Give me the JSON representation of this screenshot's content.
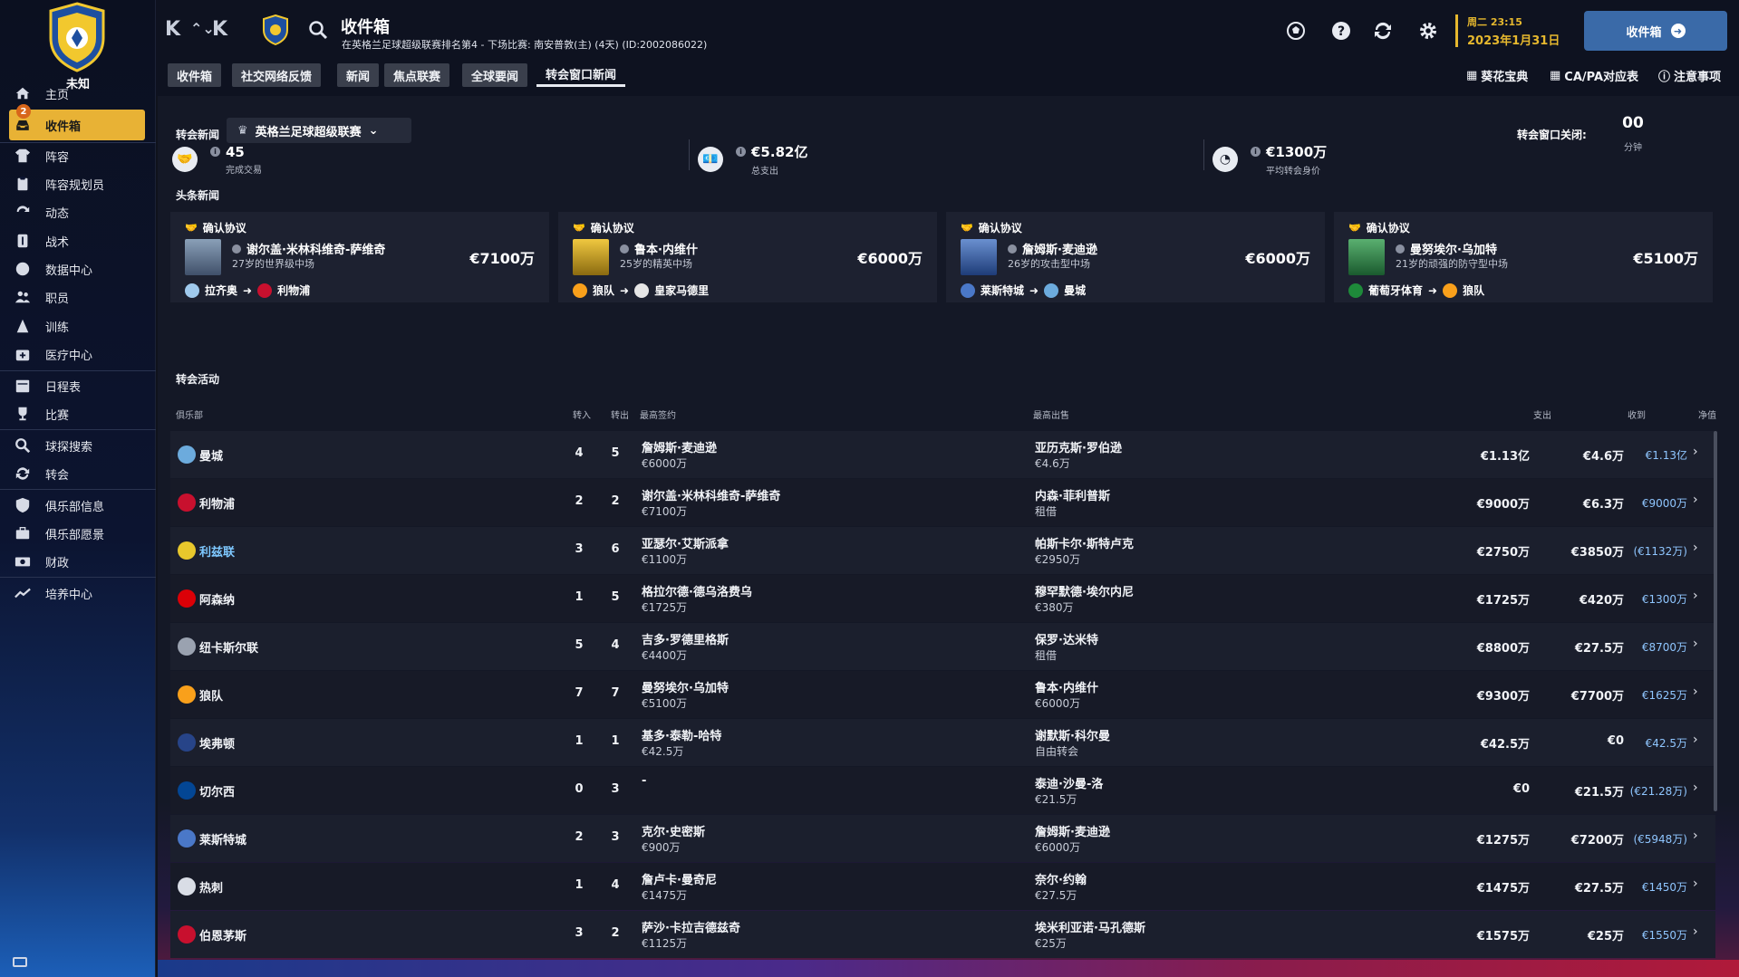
{
  "club": {
    "name": "未知"
  },
  "sidebar": {
    "items": [
      {
        "label": "主页",
        "icon": "home-icon"
      },
      {
        "label": "收件箱",
        "icon": "inbox-icon",
        "badge": "2"
      },
      {
        "label": "阵容",
        "icon": "squad-shirt-icon"
      },
      {
        "label": "阵容规划员",
        "icon": "clipboard-icon"
      },
      {
        "label": "动态",
        "icon": "dynamics-icon"
      },
      {
        "label": "战术",
        "icon": "tactics-icon"
      },
      {
        "label": "数据中心",
        "icon": "data-hub-icon"
      },
      {
        "label": "职员",
        "icon": "staff-icon"
      },
      {
        "label": "训练",
        "icon": "training-icon"
      },
      {
        "label": "医疗中心",
        "icon": "medical-icon"
      },
      {
        "label": "日程表",
        "icon": "calendar-icon"
      },
      {
        "label": "比赛",
        "icon": "trophy-icon"
      },
      {
        "label": "球探搜索",
        "icon": "scouting-icon"
      },
      {
        "label": "转会",
        "icon": "transfers-icon"
      },
      {
        "label": "俱乐部信息",
        "icon": "club-info-icon"
      },
      {
        "label": "俱乐部愿景",
        "icon": "club-vision-icon"
      },
      {
        "label": "财政",
        "icon": "finances-icon"
      },
      {
        "label": "培养中心",
        "icon": "development-icon"
      }
    ]
  },
  "header": {
    "title": "收件箱",
    "subtitle": "在英格兰足球超级联赛排名第4 - 下场比赛: 南安普敦(主) (4天) (ID:2002086022)",
    "date_day": "周二 23:15",
    "date_full": "2023年1月31日",
    "inbox_button": "收件箱"
  },
  "tabs": [
    "收件箱",
    "社交网络反馈",
    "新闻",
    "焦点联赛",
    "全球要闻",
    "转会窗口新闻"
  ],
  "active_tab": 5,
  "top_links": [
    "葵花宝典",
    "CA/PA对应表",
    "注意事项"
  ],
  "transfer_news": {
    "label": "转会新闻",
    "league": "英格兰足球超级联赛",
    "window_close_label": "转会窗口关闭:",
    "window_close_value": "00",
    "window_close_unit": "分钟"
  },
  "stats": [
    {
      "value": "45",
      "label": "完成交易",
      "icon": "handshake-icon"
    },
    {
      "value": "€5.82亿",
      "label": "总支出",
      "icon": "money-icon"
    },
    {
      "value": "€1300万",
      "label": "平均转会身价",
      "icon": "average-value-icon"
    }
  ],
  "headlines_label": "头条新闻",
  "headlines": [
    {
      "status": "确认协议",
      "player": "谢尔盖·米林科维奇-萨维奇",
      "desc": "27岁的世界级中场",
      "fee": "€7100万",
      "from": "拉齐奥",
      "to": "利物浦",
      "photo_color": "#6a7f9a",
      "from_color": "#9fc9ec",
      "to_color": "#c8102e"
    },
    {
      "status": "确认协议",
      "player": "鲁本·内维什",
      "desc": "25岁的精英中场",
      "fee": "€6000万",
      "from": "狼队",
      "to": "皇家马德里",
      "photo_color": "#e0b020",
      "from_color": "#f9a01b",
      "to_color": "#e6e6e6"
    },
    {
      "status": "确认协议",
      "player": "詹姆斯·麦迪逊",
      "desc": "26岁的攻击型中场",
      "fee": "€6000万",
      "from": "莱斯特城",
      "to": "曼城",
      "photo_color": "#3a66b0",
      "from_color": "#4a78c8",
      "to_color": "#6cabdd"
    },
    {
      "status": "确认协议",
      "player": "曼努埃尔·乌加特",
      "desc": "21岁的顽强的防守型中场",
      "fee": "€5100万",
      "from": "葡萄牙体育",
      "to": "狼队",
      "photo_color": "#2f8a4a",
      "from_color": "#1e8a3a",
      "to_color": "#f9a01b"
    }
  ],
  "activity_label": "转会活动",
  "table_headers": {
    "club": "俱乐部",
    "in": "转入",
    "out": "转出",
    "top_signing": "最高签约",
    "top_sale": "最高出售",
    "spend": "支出",
    "received": "收到",
    "net": "净值"
  },
  "rows": [
    {
      "club": "曼城",
      "crest": "#6cabdd",
      "in": "4",
      "out": "5",
      "sign": "詹姆斯·麦迪逊",
      "sign_fee": "€6000万",
      "sale": "亚历克斯·罗伯逊",
      "sale_fee": "€4.6万",
      "spend": "€1.13亿",
      "received": "€4.6万",
      "net": "€1.13亿"
    },
    {
      "club": "利物浦",
      "crest": "#c8102e",
      "in": "2",
      "out": "2",
      "sign": "谢尔盖·米林科维奇-萨维奇",
      "sign_fee": "€7100万",
      "sale": "内森·菲利普斯",
      "sale_fee": "租借",
      "spend": "€9000万",
      "received": "€6.3万",
      "net": "€9000万"
    },
    {
      "club": "利兹联",
      "crest": "#e8c82c",
      "highlight": true,
      "in": "3",
      "out": "6",
      "sign": "亚瑟尔·艾斯派拿",
      "sign_fee": "€1100万",
      "sale": "帕斯卡尔·斯特卢克",
      "sale_fee": "€2950万",
      "spend": "€2750万",
      "received": "€3850万",
      "net": "(€1132万)"
    },
    {
      "club": "阿森纳",
      "crest": "#db0007",
      "in": "1",
      "out": "5",
      "sign": "格拉尔德·德乌洛费乌",
      "sign_fee": "€1725万",
      "sale": "穆罕默德·埃尔内尼",
      "sale_fee": "€380万",
      "spend": "€1725万",
      "received": "€420万",
      "net": "€1300万"
    },
    {
      "club": "纽卡斯尔联",
      "crest": "#9aa2b0",
      "in": "5",
      "out": "4",
      "sign": "吉多·罗德里格斯",
      "sign_fee": "€4400万",
      "sale": "保罗·达米特",
      "sale_fee": "租借",
      "spend": "€8800万",
      "received": "€27.5万",
      "net": "€8700万"
    },
    {
      "club": "狼队",
      "crest": "#f9a01b",
      "in": "7",
      "out": "7",
      "sign": "曼努埃尔·乌加特",
      "sign_fee": "€5100万",
      "sale": "鲁本·内维什",
      "sale_fee": "€6000万",
      "spend": "€9300万",
      "received": "€7700万",
      "net": "€1625万"
    },
    {
      "club": "埃弗顿",
      "crest": "#274488",
      "in": "1",
      "out": "1",
      "sign": "基多·泰勒-哈特",
      "sign_fee": "€42.5万",
      "sale": "谢默斯·科尔曼",
      "sale_fee": "自由转会",
      "spend": "€42.5万",
      "received": "€0",
      "net": "€42.5万"
    },
    {
      "club": "切尔西",
      "crest": "#034694",
      "in": "0",
      "out": "3",
      "sign": "-",
      "sign_fee": "",
      "sale": "泰迪·沙曼-洛",
      "sale_fee": "€21.5万",
      "spend": "€0",
      "received": "€21.5万",
      "net": "(€21.28万)"
    },
    {
      "club": "莱斯特城",
      "crest": "#4a78c8",
      "in": "2",
      "out": "3",
      "sign": "克尔·史密斯",
      "sign_fee": "€900万",
      "sale": "詹姆斯·麦迪逊",
      "sale_fee": "€6000万",
      "spend": "€1275万",
      "received": "€7200万",
      "net": "(€5948万)"
    },
    {
      "club": "热刺",
      "crest": "#d9dde6",
      "in": "1",
      "out": "4",
      "sign": "詹卢卡·曼奇尼",
      "sign_fee": "€1475万",
      "sale": "奈尔·约翰",
      "sale_fee": "€27.5万",
      "spend": "€1475万",
      "received": "€27.5万",
      "net": "€1450万"
    },
    {
      "club": "伯恩茅斯",
      "crest": "#c8102e",
      "in": "3",
      "out": "2",
      "sign": "萨沙·卡拉吉德兹奇",
      "sign_fee": "€1125万",
      "sale": "埃米利亚诺·马孔德斯",
      "sale_fee": "€25万",
      "spend": "€1575万",
      "received": "€25万",
      "net": "€1550万"
    }
  ]
}
